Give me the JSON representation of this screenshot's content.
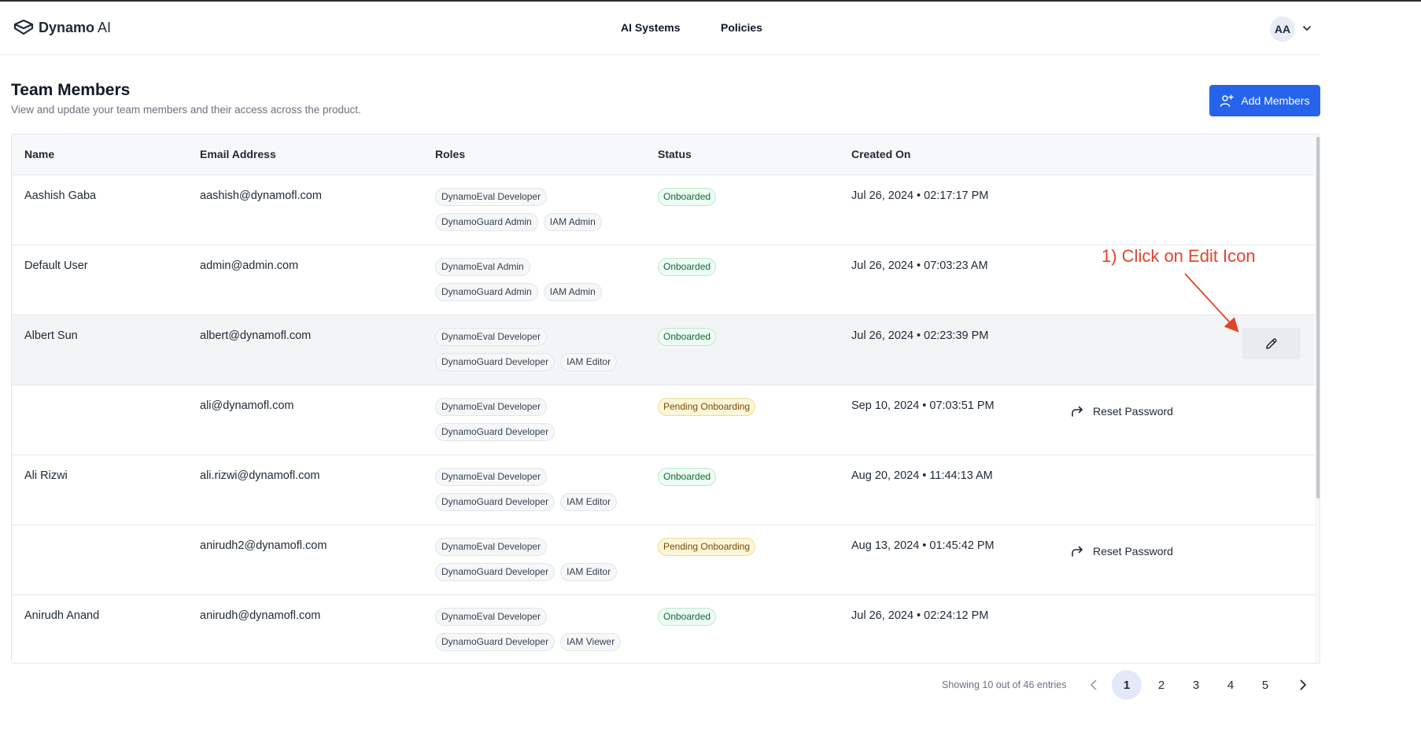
{
  "header": {
    "brand": "Dynamo",
    "brand_suffix": "AI",
    "nav": [
      "AI Systems",
      "Policies"
    ],
    "avatar_initials": "AA"
  },
  "page": {
    "title": "Team Members",
    "subtitle": "View and update your team members and their access across the product.",
    "add_button": "Add Members"
  },
  "table": {
    "columns": [
      "Name",
      "Email Address",
      "Roles",
      "Status",
      "Created On"
    ],
    "rows": [
      {
        "name": "Aashish Gaba",
        "email": "aashish@dynamofl.com",
        "roles": [
          [
            "DynamoEval Developer"
          ],
          [
            "DynamoGuard Admin",
            "IAM Admin"
          ]
        ],
        "status": "Onboarded",
        "created": "Jul 26, 2024 • 02:17:17 PM"
      },
      {
        "name": "Default User",
        "email": "admin@admin.com",
        "roles": [
          [
            "DynamoEval Admin"
          ],
          [
            "DynamoGuard Admin",
            "IAM Admin"
          ]
        ],
        "status": "Onboarded",
        "created": "Jul 26, 2024 • 07:03:23 AM"
      },
      {
        "name": "Albert Sun",
        "email": "albert@dynamofl.com",
        "roles": [
          [
            "DynamoEval Developer"
          ],
          [
            "DynamoGuard Developer",
            "IAM Editor"
          ]
        ],
        "status": "Onboarded",
        "created": "Jul 26, 2024 • 02:23:39 PM"
      },
      {
        "name": "",
        "email": "ali@dynamofl.com",
        "roles": [
          [
            "DynamoEval Developer"
          ],
          [
            "DynamoGuard Developer"
          ]
        ],
        "status": "Pending Onboarding",
        "created": "Sep 10, 2024 • 07:03:51 PM"
      },
      {
        "name": "Ali Rizwi",
        "email": "ali.rizwi@dynamofl.com",
        "roles": [
          [
            "DynamoEval Developer"
          ],
          [
            "DynamoGuard Developer",
            "IAM Editor"
          ]
        ],
        "status": "Onboarded",
        "created": "Aug 20, 2024 • 11:44:13 AM"
      },
      {
        "name": "",
        "email": "anirudh2@dynamofl.com",
        "roles": [
          [
            "DynamoEval Developer"
          ],
          [
            "DynamoGuard Developer",
            "IAM Editor"
          ]
        ],
        "status": "Pending Onboarding",
        "created": "Aug 13, 2024 • 01:45:42 PM"
      },
      {
        "name": "Anirudh Anand",
        "email": "anirudh@dynamofl.com",
        "roles": [
          [
            "DynamoEval Developer"
          ],
          [
            "DynamoGuard Developer",
            "IAM Viewer"
          ]
        ],
        "status": "Onboarded",
        "created": "Jul 26, 2024 • 02:24:12 PM"
      }
    ],
    "reset_password_label": "Reset Password"
  },
  "annotation": "1) Click on Edit Icon",
  "pagination": {
    "info": "Showing 10 out of 46 entries",
    "pages": [
      "1",
      "2",
      "3",
      "4",
      "5"
    ],
    "current": "1"
  },
  "colors": {
    "accent": "#2563eb",
    "annotation": "#e0452b",
    "onboarded_bg": "#ecfdf3",
    "pending_bg": "#fdf6d8"
  }
}
